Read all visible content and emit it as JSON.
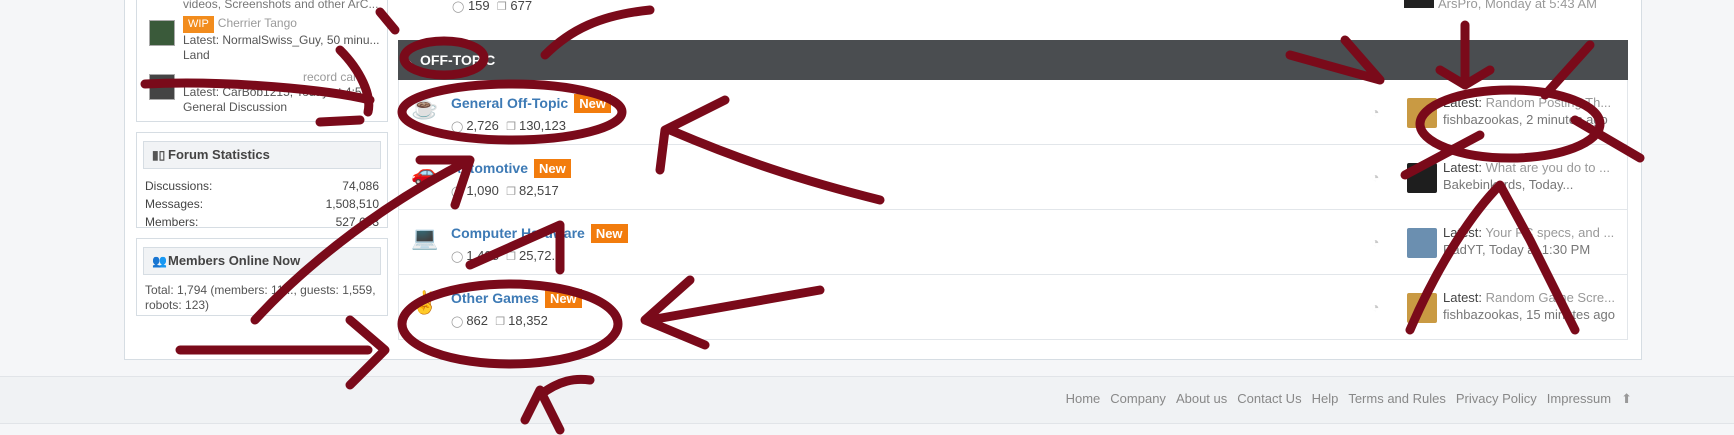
{
  "sidebar": {
    "top_snippet": "videos, Screenshots and other ArC...",
    "recent": [
      {
        "badge": "WIP",
        "title": "Cherrier Tango",
        "latest": "Latest: NormalSwiss_Guy, 50 minu...",
        "forum": "Land"
      },
      {
        "badge": "",
        "title": "record cars",
        "latest": "Latest: CarBob1215, Today at 4:5...",
        "forum": "General Discussion"
      }
    ],
    "stats": {
      "title": "Forum Statistics",
      "rows": [
        {
          "label": "Discussions:",
          "value": "74,086"
        },
        {
          "label": "Messages:",
          "value": "1,508,510"
        },
        {
          "label": "Members:",
          "value": "527,603"
        }
      ]
    },
    "online": {
      "title": "Members Online Now",
      "text": "Total: 1,794 (members: 11..., guests: 1,559, robots: 123)"
    }
  },
  "top_row": {
    "threads": "159",
    "messages": "677",
    "latest": "ArsPro, Monday at 5:43 AM"
  },
  "category": {
    "title": "OFF-TOPIC"
  },
  "nodes": [
    {
      "title": "General Off-Topic",
      "badge": "New",
      "threads": "2,726",
      "messages": "130,123",
      "latest_label": "Latest:",
      "latest_title": "Random Posting Th...",
      "latest_user": "fishbazookas, 2 minutes ago",
      "icon": "coffee-cup-icon"
    },
    {
      "title": "Automotive",
      "badge": "New",
      "threads": "1,090",
      "messages": "82,517",
      "latest_label": "Latest:",
      "latest_title": "What are you do to ...",
      "latest_user": "Bakebinkards, Today...",
      "icon": "car-icon"
    },
    {
      "title": "Computer Hardware",
      "badge": "New",
      "threads": "1,408",
      "messages": "25,72...",
      "latest_label": "Latest:",
      "latest_title": "Your PC specs, and ...",
      "latest_user": "RadYT, Today at 1:30 PM",
      "icon": "laptop-icon"
    },
    {
      "title": "Other Games",
      "badge": "New",
      "threads": "862",
      "messages": "18,352",
      "latest_label": "Latest:",
      "latest_title": "Random Game Scre...",
      "latest_user": "fishbazookas, 15 minutes ago",
      "icon": "peace-hand-icon"
    }
  ],
  "footer": {
    "links": [
      "Home",
      "Company",
      "About us",
      "Contact Us",
      "Help",
      "Terms and Rules",
      "Privacy Policy",
      "Impressum"
    ]
  },
  "colors": {
    "accent": "#3d7ab5",
    "new_badge": "#f27c0d",
    "category_bar": "#4a4d50",
    "annotation": "#7a0a1a"
  }
}
